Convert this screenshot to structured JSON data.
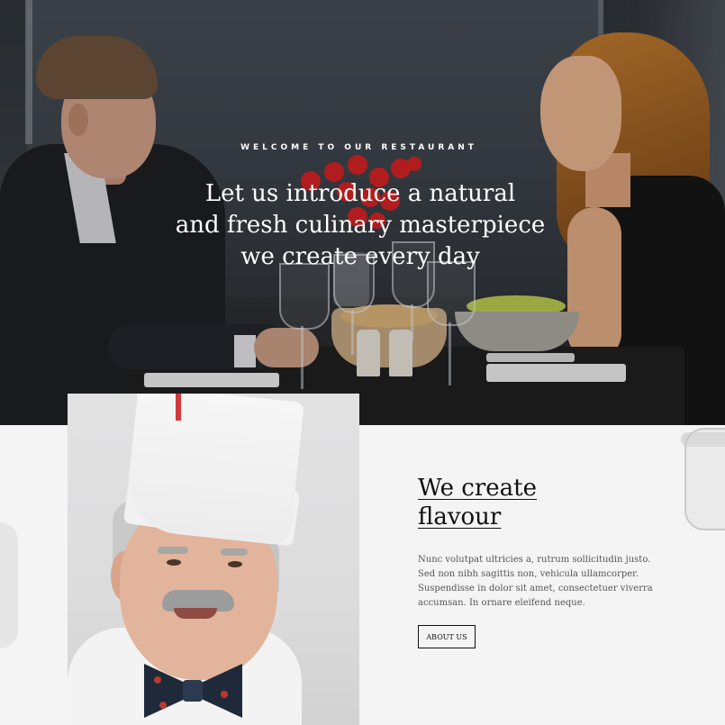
{
  "hero": {
    "eyebrow": "WELCOME TO OUR RESTAURANT",
    "headline_lines": [
      "Let us introduce a natural",
      "and fresh culinary masterpiece",
      "we create every day"
    ]
  },
  "about": {
    "title_lines": [
      "We create",
      "flavour"
    ],
    "body_lines": [
      "Nunc volutpat ultricies a, rutrum sollicitudin justo.",
      "Sed non nibh sagittis non, vehicula ullamcorper.",
      "Suspendisse in dolor sit amet, consectetuer viverra",
      "accumsan. In ornare eleifend neque."
    ],
    "button_label": "ABOUT US"
  },
  "colors": {
    "text_dark": "#111111",
    "text_body": "#555555",
    "background": "#f4f4f4",
    "hero_text": "#ffffff"
  }
}
